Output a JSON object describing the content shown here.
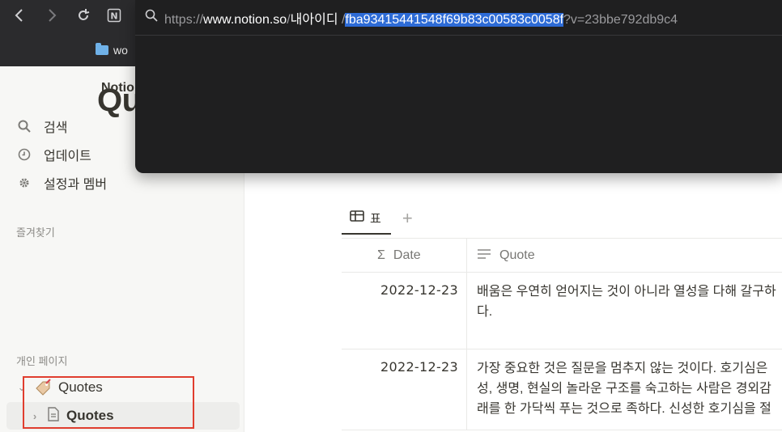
{
  "browser": {
    "bookmark_label": "wo",
    "url": {
      "scheme": "https://",
      "host": "www.notion.so",
      "slash1": "/",
      "path": "내아이디",
      "slash2": " /",
      "selected": "fba93415441548f69b83c00583c0058f",
      "query": "?v=23bbe792db9c4"
    }
  },
  "sidebar": {
    "workspace": "Notio",
    "items": [
      {
        "label": "검색",
        "icon": "search-icon"
      },
      {
        "label": "업데이트",
        "icon": "clock-icon"
      },
      {
        "label": "설정과 멤버",
        "icon": "gear-icon"
      }
    ],
    "favorites_label": "즐겨찾기",
    "private_label": "개인 페이지",
    "pages": [
      {
        "label": "Quotes",
        "icon": "tag-icon"
      },
      {
        "label": "Quotes",
        "icon": "page-icon"
      }
    ]
  },
  "main": {
    "title": "Quotes",
    "view_tab": "표",
    "columns": [
      "Date",
      "Quote"
    ],
    "rows": [
      {
        "date": "2022-12-23",
        "quote": "배움은 우연히 얻어지는 것이 아니라 열성을 다해 갈구하\n다."
      },
      {
        "date": "2022-12-23",
        "quote": "가장 중요한 것은 질문을 멈추지 않는 것이다. 호기심은 \n성, 생명, 현실의 놀라운 구조를 숙고하는 사람은 경외감\n래를 한 가닥씩 푸는 것으로 족하다. 신성한 호기심을 절"
      }
    ]
  },
  "colors": {
    "highlight": "#e03e2f",
    "url_selection": "#2d6bd6"
  }
}
